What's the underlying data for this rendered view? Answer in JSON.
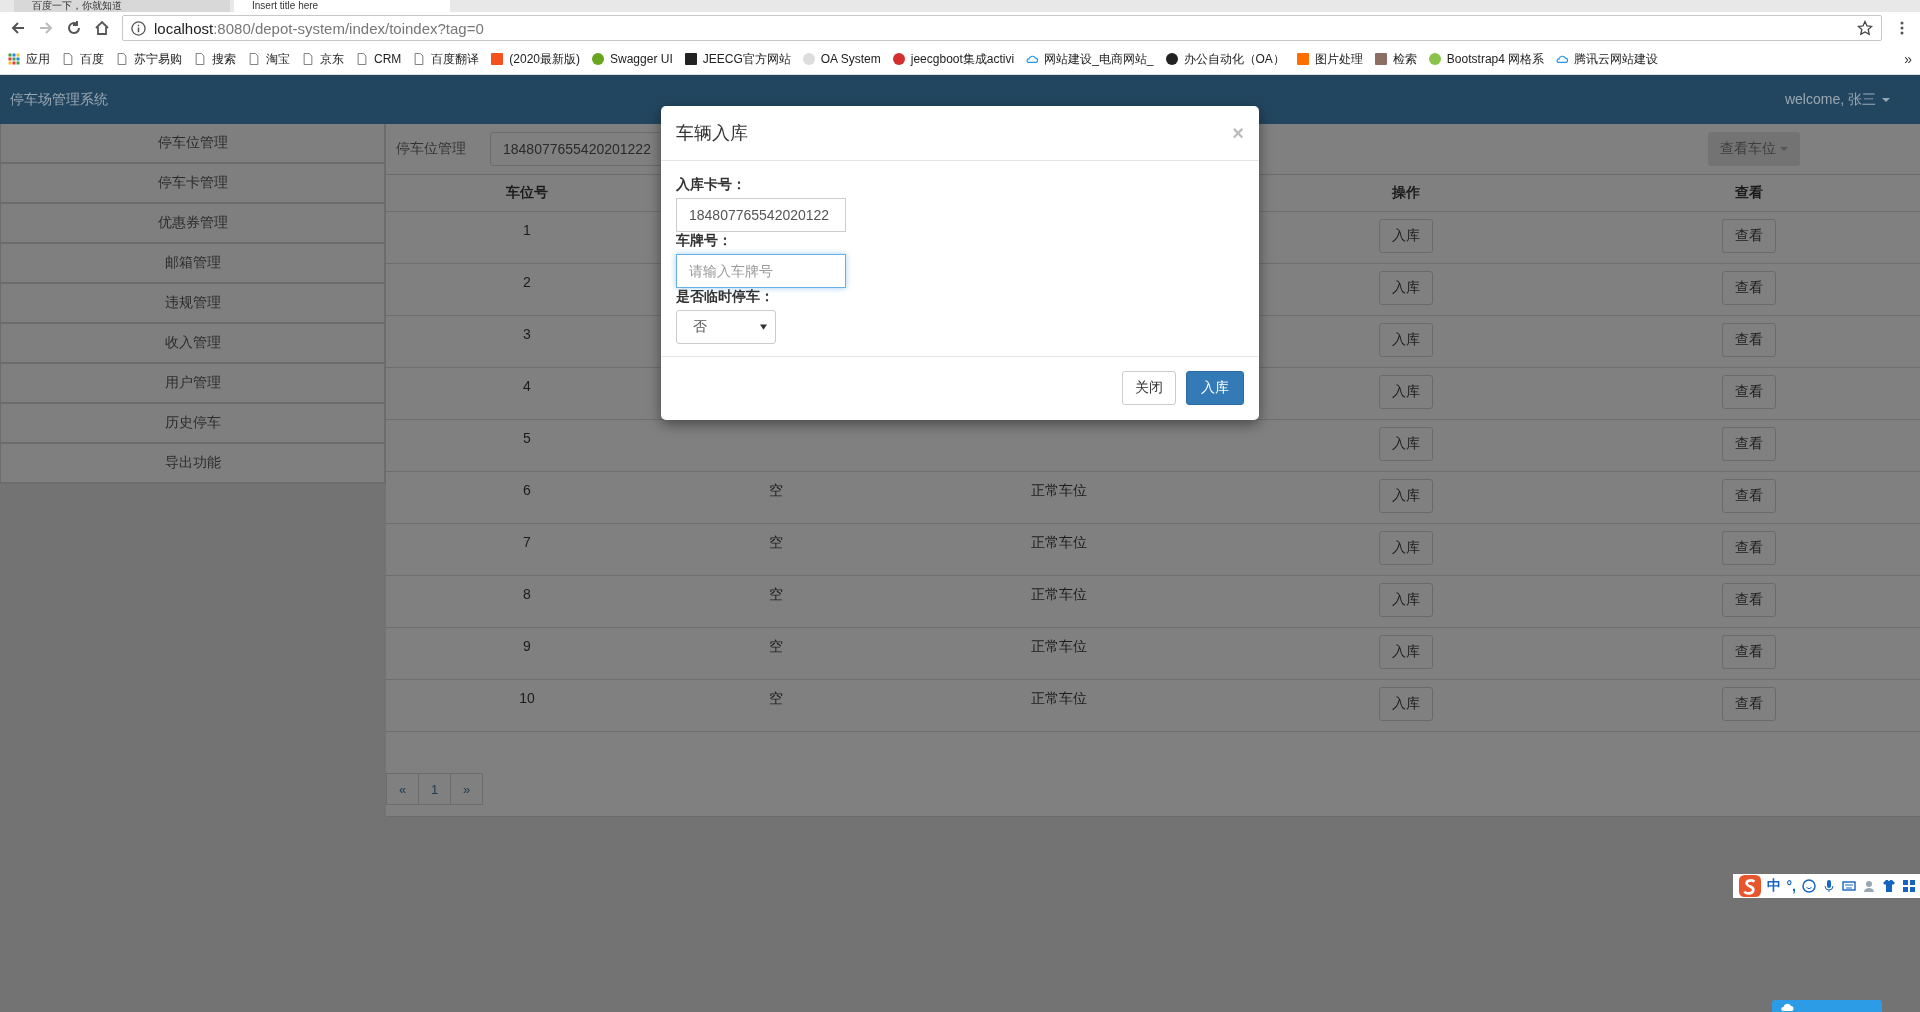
{
  "browser": {
    "tabs": [
      {
        "title": "百度一下，你就知道",
        "selected": false
      },
      {
        "title": "Insert title here",
        "selected": true
      }
    ],
    "url": {
      "host": "localhost",
      "path": ":8080/depot-system/index/toindex?tag=0"
    },
    "bookmarks": [
      {
        "label": "应用",
        "kind": "apps"
      },
      {
        "label": "百度",
        "kind": "page"
      },
      {
        "label": "苏宁易购",
        "kind": "page"
      },
      {
        "label": "搜索",
        "kind": "page"
      },
      {
        "label": "淘宝",
        "kind": "page"
      },
      {
        "label": "京东",
        "kind": "page"
      },
      {
        "label": "CRM",
        "kind": "page"
      },
      {
        "label": "百度翻译",
        "kind": "page"
      },
      {
        "label": "(2020最新版)",
        "kind": "square",
        "color": "#f4511e"
      },
      {
        "label": "Swagger UI",
        "kind": "round",
        "color": "#6aa51e"
      },
      {
        "label": "JEECG官方网站",
        "kind": "square",
        "color": "#222222"
      },
      {
        "label": "OA System",
        "kind": "round",
        "color": "#dddddd"
      },
      {
        "label": "jeecgboot集成activi",
        "kind": "round",
        "color": "#d32f2f"
      },
      {
        "label": "网站建设_电商网站_",
        "kind": "cloud",
        "color": "#2196f3"
      },
      {
        "label": "办公自动化（OA）",
        "kind": "round",
        "color": "#222222"
      },
      {
        "label": "图片处理",
        "kind": "square",
        "color": "#ff6d00"
      },
      {
        "label": "检索",
        "kind": "square",
        "color": "#8d6e63"
      },
      {
        "label": "Bootstrap4 网格系",
        "kind": "round",
        "color": "#8bc34a"
      },
      {
        "label": "腾讯云网站建设",
        "kind": "cloud",
        "color": "#2196f3"
      }
    ],
    "more": "»"
  },
  "app": {
    "title": "停车场管理系统",
    "user": "welcome, 张三"
  },
  "sidebar": {
    "items": [
      {
        "label": "停车位管理"
      },
      {
        "label": "停车卡管理"
      },
      {
        "label": "优惠券管理"
      },
      {
        "label": "邮箱管理"
      },
      {
        "label": "违规管理"
      },
      {
        "label": "收入管理"
      },
      {
        "label": "用户管理"
      },
      {
        "label": "历史停车"
      },
      {
        "label": "导出功能"
      }
    ]
  },
  "toolbar": {
    "label": "停车位管理",
    "card_number": "1848077655420201222",
    "view_button": "查看车位"
  },
  "table": {
    "columns": {
      "column_1": "车位号",
      "column_4": "操作",
      "column_5": "查看"
    },
    "rows": [
      {
        "number": "1",
        "action": "入库",
        "view": "查看"
      },
      {
        "number": "2",
        "action": "入库",
        "view": "查看"
      },
      {
        "number": "3",
        "action": "入库",
        "view": "查看"
      },
      {
        "number": "4",
        "action": "入库",
        "view": "查看"
      },
      {
        "number": "5",
        "action": "入库",
        "view": "查看"
      },
      {
        "number": "6",
        "column_2": "空",
        "column_3": "正常车位",
        "action": "入库",
        "view": "查看"
      },
      {
        "number": "7",
        "column_2": "空",
        "column_3": "正常车位",
        "action": "入库",
        "view": "查看"
      },
      {
        "number": "8",
        "column_2": "空",
        "column_3": "正常车位",
        "action": "入库",
        "view": "查看"
      },
      {
        "number": "9",
        "column_2": "空",
        "column_3": "正常车位",
        "action": "入库",
        "view": "查看"
      },
      {
        "number": "10",
        "column_2": "空",
        "column_3": "正常车位",
        "action": "入库",
        "view": "查看"
      }
    ]
  },
  "pagination": [
    {
      "label": "«"
    },
    {
      "label": "1"
    },
    {
      "label": "»"
    }
  ],
  "modal": {
    "title": "车辆入库",
    "close": "×",
    "fields": [
      {
        "label": "入库卡号：",
        "kind": "input",
        "value": "184807765542020122",
        "focused": false
      },
      {
        "label": "车牌号：",
        "kind": "input",
        "placeholder": "请输入车牌号",
        "focused": true
      },
      {
        "label": "是否临时停车：",
        "kind": "select",
        "value": "否",
        "focused": false
      }
    ],
    "buttons": [
      {
        "label": "关闭",
        "kind": "default"
      },
      {
        "label": "入库",
        "kind": "primary"
      }
    ]
  },
  "ime": {
    "mode": "中",
    "punct": "°,"
  }
}
